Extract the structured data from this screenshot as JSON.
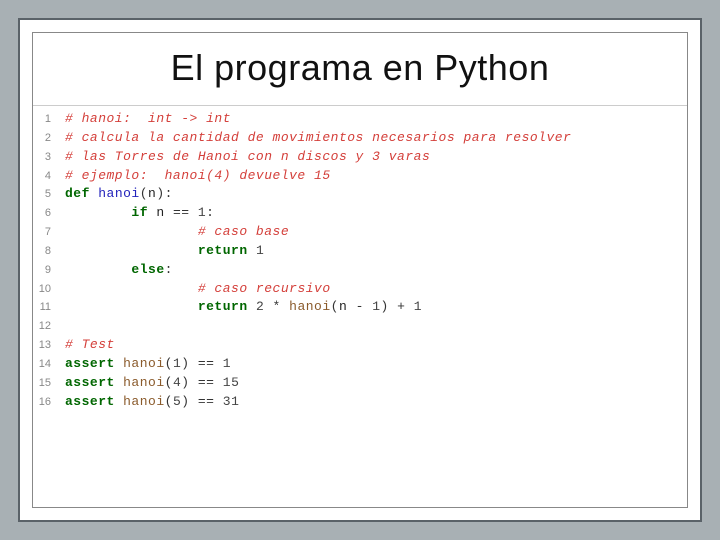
{
  "slide": {
    "title": "El programa en Python"
  },
  "code": {
    "lines": [
      {
        "n": "1",
        "tokens": [
          {
            "t": "# hanoi:  int -> int",
            "c": "tok-comment"
          }
        ]
      },
      {
        "n": "2",
        "tokens": [
          {
            "t": "# calcula la cantidad de movimientos necesarios para resolver",
            "c": "tok-comment"
          }
        ]
      },
      {
        "n": "3",
        "tokens": [
          {
            "t": "# las Torres de Hanoi con n discos y 3 varas",
            "c": "tok-comment"
          }
        ]
      },
      {
        "n": "4",
        "tokens": [
          {
            "t": "# ejemplo:  hanoi(4) devuelve 15",
            "c": "tok-comment"
          }
        ]
      },
      {
        "n": "5",
        "tokens": [
          {
            "t": "def ",
            "c": "tok-keyword"
          },
          {
            "t": "hanoi",
            "c": "tok-funcdef"
          },
          {
            "t": "(",
            "c": "tok-punc"
          },
          {
            "t": "n",
            "c": "tok-name"
          },
          {
            "t": "):",
            "c": "tok-punc"
          }
        ]
      },
      {
        "n": "6",
        "tokens": [
          {
            "t": "        ",
            "c": ""
          },
          {
            "t": "if ",
            "c": "tok-keyword"
          },
          {
            "t": "n ",
            "c": "tok-name"
          },
          {
            "t": "== ",
            "c": "tok-op"
          },
          {
            "t": "1",
            "c": "tok-num"
          },
          {
            "t": ":",
            "c": "tok-punc"
          }
        ]
      },
      {
        "n": "7",
        "tokens": [
          {
            "t": "                ",
            "c": ""
          },
          {
            "t": "# caso base",
            "c": "tok-comment"
          }
        ]
      },
      {
        "n": "8",
        "tokens": [
          {
            "t": "                ",
            "c": ""
          },
          {
            "t": "return ",
            "c": "tok-keyword"
          },
          {
            "t": "1",
            "c": "tok-num"
          }
        ]
      },
      {
        "n": "9",
        "tokens": [
          {
            "t": "        ",
            "c": ""
          },
          {
            "t": "else",
            "c": "tok-keyword"
          },
          {
            "t": ":",
            "c": "tok-punc"
          }
        ]
      },
      {
        "n": "10",
        "tokens": [
          {
            "t": "                ",
            "c": ""
          },
          {
            "t": "# caso recursivo",
            "c": "tok-comment"
          }
        ]
      },
      {
        "n": "11",
        "tokens": [
          {
            "t": "                ",
            "c": ""
          },
          {
            "t": "return ",
            "c": "tok-keyword"
          },
          {
            "t": "2",
            "c": "tok-num"
          },
          {
            "t": " * ",
            "c": "tok-op"
          },
          {
            "t": "hanoi",
            "c": "tok-funccall"
          },
          {
            "t": "(",
            "c": "tok-punc"
          },
          {
            "t": "n ",
            "c": "tok-name"
          },
          {
            "t": "- ",
            "c": "tok-op"
          },
          {
            "t": "1",
            "c": "tok-num"
          },
          {
            "t": ") ",
            "c": "tok-punc"
          },
          {
            "t": "+ ",
            "c": "tok-op"
          },
          {
            "t": "1",
            "c": "tok-num"
          }
        ]
      },
      {
        "n": "12",
        "tokens": [
          {
            "t": " ",
            "c": ""
          }
        ]
      },
      {
        "n": "13",
        "tokens": [
          {
            "t": "# Test",
            "c": "tok-comment"
          }
        ]
      },
      {
        "n": "14",
        "tokens": [
          {
            "t": "assert ",
            "c": "tok-keyword"
          },
          {
            "t": "hanoi",
            "c": "tok-funccall"
          },
          {
            "t": "(",
            "c": "tok-punc"
          },
          {
            "t": "1",
            "c": "tok-num"
          },
          {
            "t": ") ",
            "c": "tok-punc"
          },
          {
            "t": "== ",
            "c": "tok-op"
          },
          {
            "t": "1",
            "c": "tok-num"
          }
        ]
      },
      {
        "n": "15",
        "tokens": [
          {
            "t": "assert ",
            "c": "tok-keyword"
          },
          {
            "t": "hanoi",
            "c": "tok-funccall"
          },
          {
            "t": "(",
            "c": "tok-punc"
          },
          {
            "t": "4",
            "c": "tok-num"
          },
          {
            "t": ") ",
            "c": "tok-punc"
          },
          {
            "t": "== ",
            "c": "tok-op"
          },
          {
            "t": "15",
            "c": "tok-num"
          }
        ]
      },
      {
        "n": "16",
        "tokens": [
          {
            "t": "assert ",
            "c": "tok-keyword"
          },
          {
            "t": "hanoi",
            "c": "tok-funccall"
          },
          {
            "t": "(",
            "c": "tok-punc"
          },
          {
            "t": "5",
            "c": "tok-num"
          },
          {
            "t": ") ",
            "c": "tok-punc"
          },
          {
            "t": "== ",
            "c": "tok-op"
          },
          {
            "t": "31",
            "c": "tok-num"
          }
        ]
      }
    ]
  }
}
